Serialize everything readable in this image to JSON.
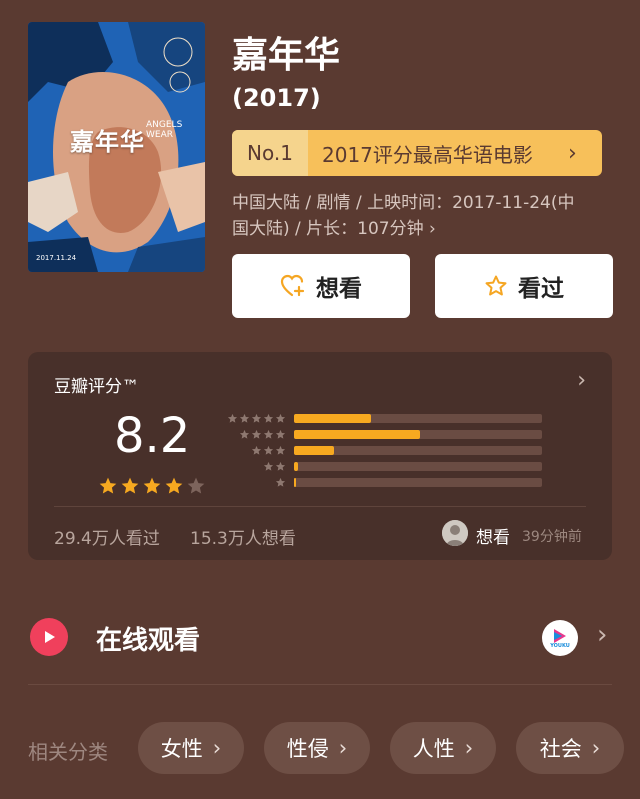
{
  "poster": {
    "title": "嘉年华",
    "subtitle": "ANGELS WEAR",
    "date": "2017.11.24"
  },
  "movie": {
    "title": "嘉年华",
    "year": "(2017)",
    "rank_no": "No.1",
    "rank_text": "2017评分最高华语电影",
    "meta_line1": "中国大陆 / 剧情 / 上映时间：2017-11-24(中",
    "meta_line2": "国大陆) / 片长：107分钟 ›"
  },
  "actions": {
    "want": "想看",
    "seen": "看过"
  },
  "rating": {
    "title": "豆瓣评分™",
    "score": "8.2",
    "stars_filled": 4,
    "stars_total": 5,
    "distribution": [
      {
        "stars": 5,
        "fraction": 0.31
      },
      {
        "stars": 4,
        "fraction": 0.51
      },
      {
        "stars": 3,
        "fraction": 0.16
      },
      {
        "stars": 2,
        "fraction": 0.015
      },
      {
        "stars": 1,
        "fraction": 0.005
      }
    ],
    "seen_count": "29.4万人看过",
    "want_count": "15.3万人想看",
    "activity_action": "想看",
    "activity_time": "39分钟前"
  },
  "watch": {
    "label": "在线观看",
    "provider": "YOUKU"
  },
  "tags": {
    "label": "相关分类",
    "items": [
      "女性",
      "性侵",
      "人性",
      "社会"
    ]
  },
  "colors": {
    "background": "#5a3a31",
    "card": "#48302a",
    "accent": "#f7a920",
    "rank_bg": "#f7c05a",
    "play": "#f0405c"
  }
}
